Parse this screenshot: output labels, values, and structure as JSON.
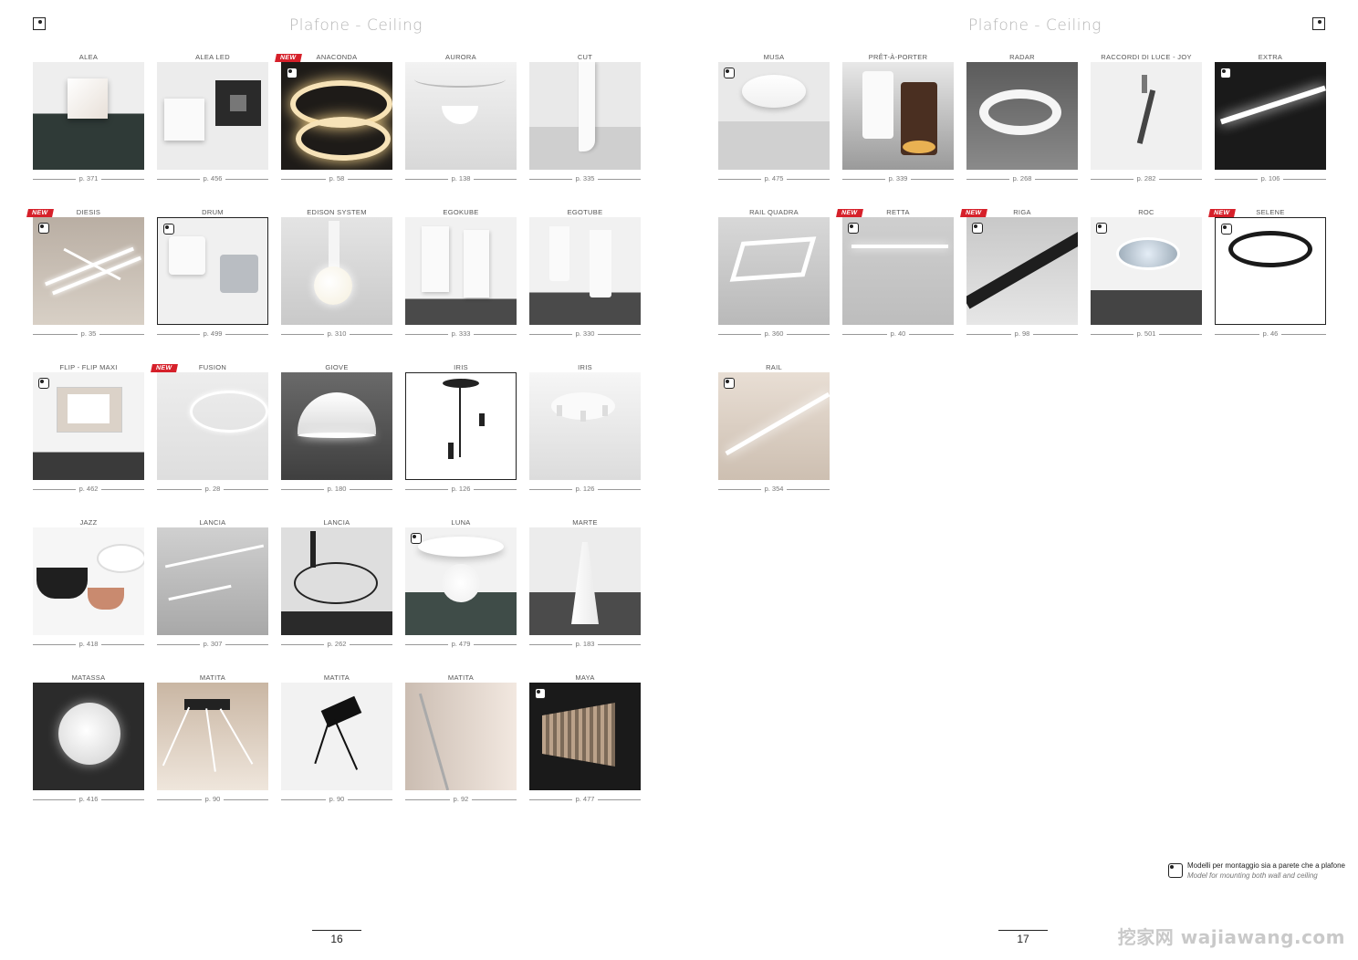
{
  "left_page": {
    "title": "Plafone - Ceiling",
    "page_number": "16",
    "products": [
      {
        "name": "ALEA",
        "page": "p. 371",
        "new": false,
        "mount_icon": false,
        "framed": false
      },
      {
        "name": "ALEA LED",
        "page": "p. 456",
        "new": false,
        "mount_icon": false,
        "framed": false
      },
      {
        "name": "ANACONDA",
        "page": "p. 58",
        "new": true,
        "mount_icon": true,
        "framed": false
      },
      {
        "name": "AURORA",
        "page": "p. 138",
        "new": false,
        "mount_icon": false,
        "framed": false
      },
      {
        "name": "CUT",
        "page": "p. 335",
        "new": false,
        "mount_icon": false,
        "framed": false
      },
      {
        "name": "DIESIS",
        "page": "p. 35",
        "new": true,
        "mount_icon": true,
        "framed": false
      },
      {
        "name": "DRUM",
        "page": "p. 499",
        "new": false,
        "mount_icon": true,
        "framed": true
      },
      {
        "name": "EDISON SYSTEM",
        "page": "p. 310",
        "new": false,
        "mount_icon": false,
        "framed": false
      },
      {
        "name": "EGOKUBE",
        "page": "p. 333",
        "new": false,
        "mount_icon": false,
        "framed": false
      },
      {
        "name": "EGOTUBE",
        "page": "p. 330",
        "new": false,
        "mount_icon": false,
        "framed": false
      },
      {
        "name": "FLIP - FLIP MAXI",
        "page": "p. 462",
        "new": false,
        "mount_icon": true,
        "framed": false
      },
      {
        "name": "FUSION",
        "page": "p. 28",
        "new": true,
        "mount_icon": false,
        "framed": false
      },
      {
        "name": "GIOVE",
        "page": "p. 180",
        "new": false,
        "mount_icon": false,
        "framed": false
      },
      {
        "name": "IRIS",
        "page": "p. 126",
        "new": false,
        "mount_icon": false,
        "framed": true
      },
      {
        "name": "IRIS",
        "page": "p. 126",
        "new": false,
        "mount_icon": false,
        "framed": false
      },
      {
        "name": "JAZZ",
        "page": "p. 418",
        "new": false,
        "mount_icon": false,
        "framed": false
      },
      {
        "name": "LANCIA",
        "page": "p. 307",
        "new": false,
        "mount_icon": false,
        "framed": false
      },
      {
        "name": "LANCIA",
        "page": "p. 262",
        "new": false,
        "mount_icon": false,
        "framed": false
      },
      {
        "name": "LUNA",
        "page": "p. 479",
        "new": false,
        "mount_icon": true,
        "framed": false
      },
      {
        "name": "MARTE",
        "page": "p. 183",
        "new": false,
        "mount_icon": false,
        "framed": false
      },
      {
        "name": "MATASSA",
        "page": "p. 416",
        "new": false,
        "mount_icon": false,
        "framed": false
      },
      {
        "name": "MATITA",
        "page": "p. 90",
        "new": false,
        "mount_icon": false,
        "framed": false
      },
      {
        "name": "MATITA",
        "page": "p. 90",
        "new": false,
        "mount_icon": false,
        "framed": false
      },
      {
        "name": "MATITA",
        "page": "p. 92",
        "new": false,
        "mount_icon": false,
        "framed": false
      },
      {
        "name": "MAYA",
        "page": "p. 477",
        "new": false,
        "mount_icon": true,
        "framed": false
      }
    ]
  },
  "right_page": {
    "title": "Plafone - Ceiling",
    "page_number": "17",
    "products": [
      {
        "name": "MUSA",
        "page": "p. 475",
        "new": false,
        "mount_icon": true,
        "framed": false
      },
      {
        "name": "PRÊT-À-PORTER",
        "page": "p. 339",
        "new": false,
        "mount_icon": false,
        "framed": false
      },
      {
        "name": "RADAR",
        "page": "p. 268",
        "new": false,
        "mount_icon": false,
        "framed": false
      },
      {
        "name": "RACCORDI DI LUCE - JOY",
        "page": "p. 282",
        "new": false,
        "mount_icon": false,
        "framed": false
      },
      {
        "name": "EXTRA",
        "page": "p. 106",
        "new": false,
        "mount_icon": true,
        "framed": false
      },
      {
        "name": "RAIL QUADRA",
        "page": "p. 360",
        "new": false,
        "mount_icon": false,
        "framed": false
      },
      {
        "name": "RETTA",
        "page": "p. 40",
        "new": true,
        "mount_icon": true,
        "framed": false
      },
      {
        "name": "RIGA",
        "page": "p. 98",
        "new": true,
        "mount_icon": true,
        "framed": false
      },
      {
        "name": "ROC",
        "page": "p. 501",
        "new": false,
        "mount_icon": true,
        "framed": false
      },
      {
        "name": "SELENE",
        "page": "p. 46",
        "new": true,
        "mount_icon": true,
        "framed": true
      },
      {
        "name": "RAIL",
        "page": "p. 354",
        "new": false,
        "mount_icon": true,
        "framed": false
      }
    ],
    "legend": {
      "italian": "Modelli per montaggio sia a parete che a plafone",
      "english": "Model for mounting both wall and ceiling"
    }
  },
  "badge_label": "NEW",
  "watermark": "挖家网 wajiawang.com",
  "colors": {
    "new_badge": "#d6202a",
    "title": "#b5b5b5",
    "rule": "#999999"
  }
}
